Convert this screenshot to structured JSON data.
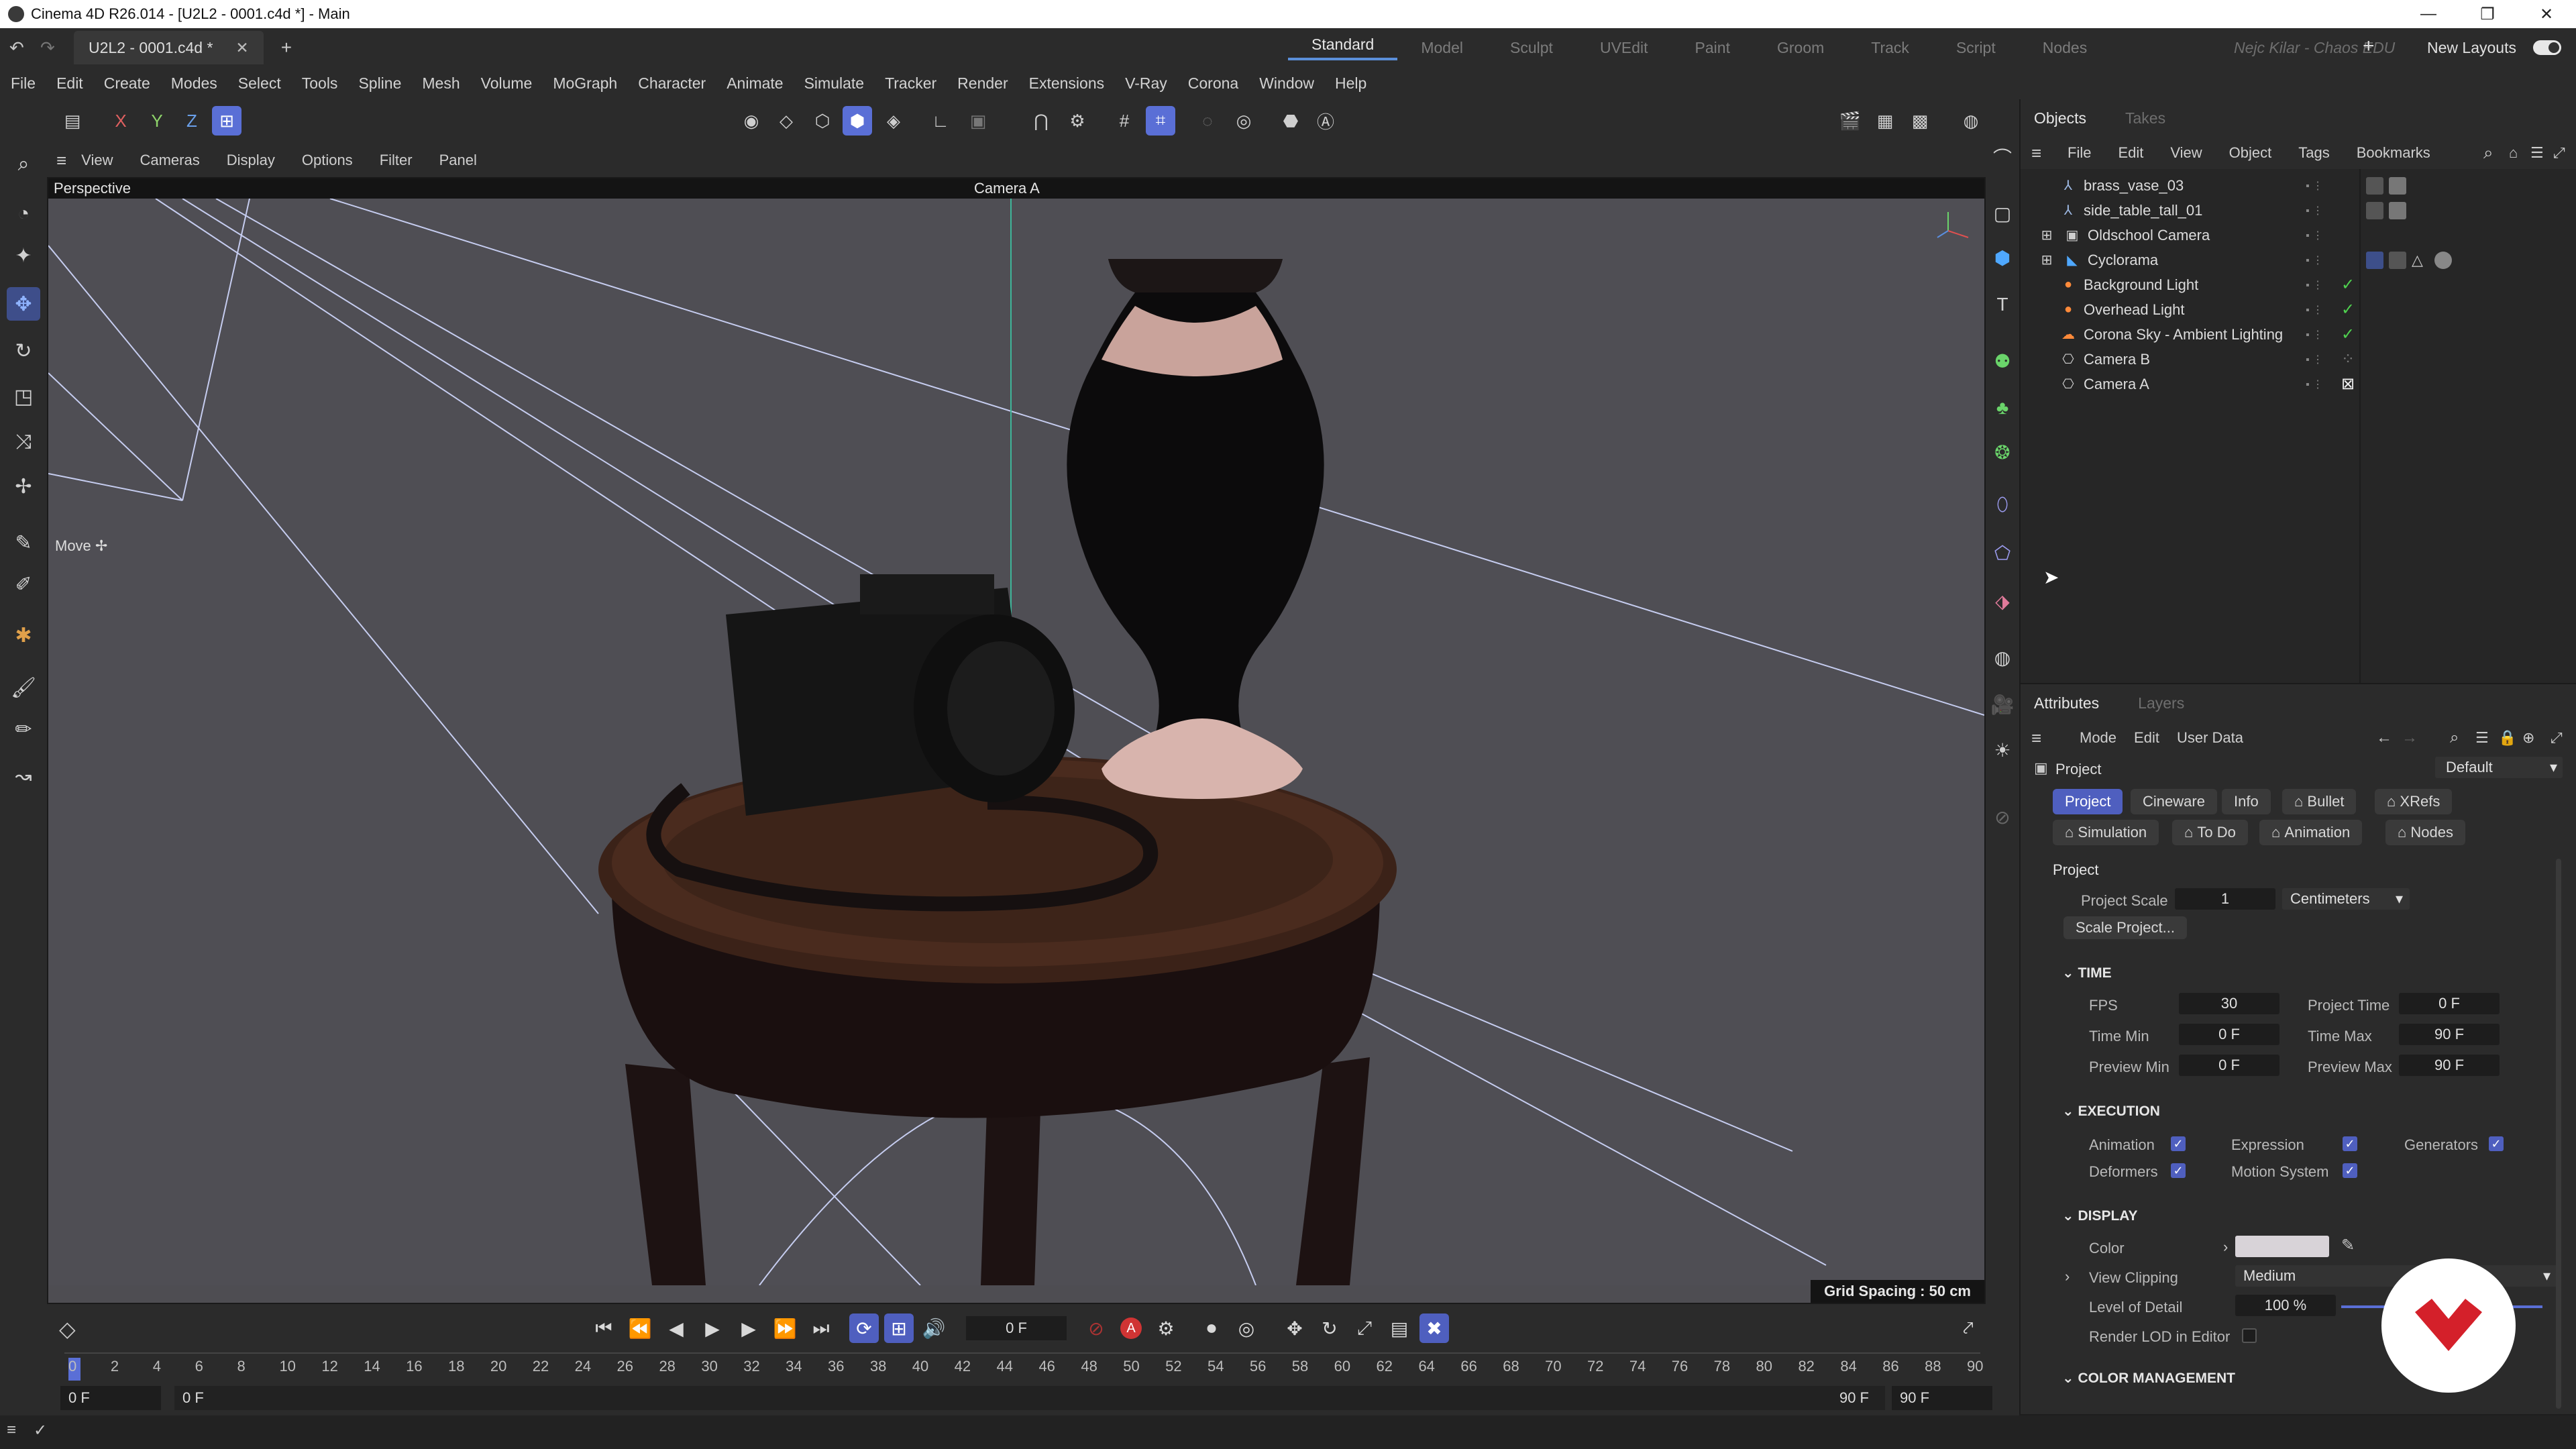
{
  "window": {
    "title": "Cinema 4D R26.014 - [U2L2 - 0001.c4d *] - Main",
    "min": "—",
    "max": "❐",
    "close": "✕"
  },
  "tabs": {
    "document": "U2L2 - 0001.c4d *",
    "close": "✕",
    "add": "+"
  },
  "layouts": [
    "Standard",
    "Model",
    "Sculpt",
    "UVEdit",
    "Paint",
    "Groom",
    "Track",
    "Script",
    "Nodes"
  ],
  "user_label": "Nejc Kilar - Chaos EDU",
  "new_layouts": "New Layouts",
  "menu": [
    "File",
    "Edit",
    "Create",
    "Modes",
    "Select",
    "Tools",
    "Spline",
    "Mesh",
    "Volume",
    "MoGraph",
    "Character",
    "Animate",
    "Simulate",
    "Tracker",
    "Render",
    "Extensions",
    "V-Ray",
    "Corona",
    "Window",
    "Help"
  ],
  "toolbar_axes": [
    "X",
    "Y",
    "Z"
  ],
  "viewport_menu": [
    "View",
    "Cameras",
    "Display",
    "Options",
    "Filter",
    "Panel"
  ],
  "viewport": {
    "label": "Perspective",
    "camera": "Camera A",
    "tool": "Move",
    "grid": "Grid Spacing : 50 cm"
  },
  "objects_panel": {
    "tabs": [
      "Objects",
      "Takes"
    ],
    "menu": [
      "File",
      "Edit",
      "View",
      "Object",
      "Tags",
      "Bookmarks"
    ],
    "items": [
      {
        "name": "brass_vase_03"
      },
      {
        "name": "side_table_tall_01"
      },
      {
        "name": "Oldschool Camera"
      },
      {
        "name": "Cyclorama"
      },
      {
        "name": "Background Light"
      },
      {
        "name": "Overhead Light"
      },
      {
        "name": "Corona Sky - Ambient Lighting"
      },
      {
        "name": "Camera B"
      },
      {
        "name": "Camera A"
      }
    ]
  },
  "attributes": {
    "tabs": [
      "Attributes",
      "Layers"
    ],
    "menu": [
      "Mode",
      "Edit",
      "User Data"
    ],
    "object": "Project",
    "preset": "Default",
    "pills_row1": [
      "Project",
      "Cineware",
      "Info",
      "Bullet",
      "XRefs"
    ],
    "pills_row2": [
      "Simulation",
      "To Do",
      "Animation",
      "Nodes"
    ],
    "section_project": "Project",
    "project_scale_label": "Project Scale",
    "project_scale": "1",
    "project_scale_unit": "Centimeters",
    "scale_project_btn": "Scale Project...",
    "time_header": "TIME",
    "fps_label": "FPS",
    "fps": "30",
    "project_time_label": "Project Time",
    "project_time": "0 F",
    "time_min_label": "Time Min",
    "time_min": "0 F",
    "time_max_label": "Time Max",
    "time_max": "90 F",
    "preview_min_label": "Preview Min",
    "preview_min": "0 F",
    "preview_max_label": "Preview Max",
    "preview_max": "90 F",
    "execution_header": "EXECUTION",
    "animation_label": "Animation",
    "expression_label": "Expression",
    "generators_label": "Generators",
    "deformers_label": "Deformers",
    "motion_label": "Motion System",
    "display_header": "DISPLAY",
    "color_label": "Color",
    "view_clipping_label": "View Clipping",
    "view_clipping": "Medium",
    "lod_label": "Level of Detail",
    "lod": "100 %",
    "render_lod_label": "Render LOD in Editor",
    "color_mgmt_header": "COLOR MANAGEMENT",
    "colors": {
      "accent": "#4f5fbf",
      "display_color": "#d8d3d8"
    }
  },
  "timeline": {
    "current_frame": "0 F",
    "start_field": "0 F",
    "start_field2": "0 F",
    "end_field": "90 F",
    "end_field2": "90 F",
    "ruler": [
      "0",
      "2",
      "4",
      "6",
      "8",
      "10",
      "12",
      "14",
      "16",
      "18",
      "20",
      "22",
      "24",
      "26",
      "28",
      "30",
      "32",
      "34",
      "36",
      "38",
      "40",
      "42",
      "44",
      "46",
      "48",
      "50",
      "52",
      "54",
      "56",
      "58",
      "60",
      "62",
      "64",
      "66",
      "68",
      "70",
      "72",
      "74",
      "76",
      "78",
      "80",
      "82",
      "84",
      "86",
      "88",
      "90"
    ]
  }
}
